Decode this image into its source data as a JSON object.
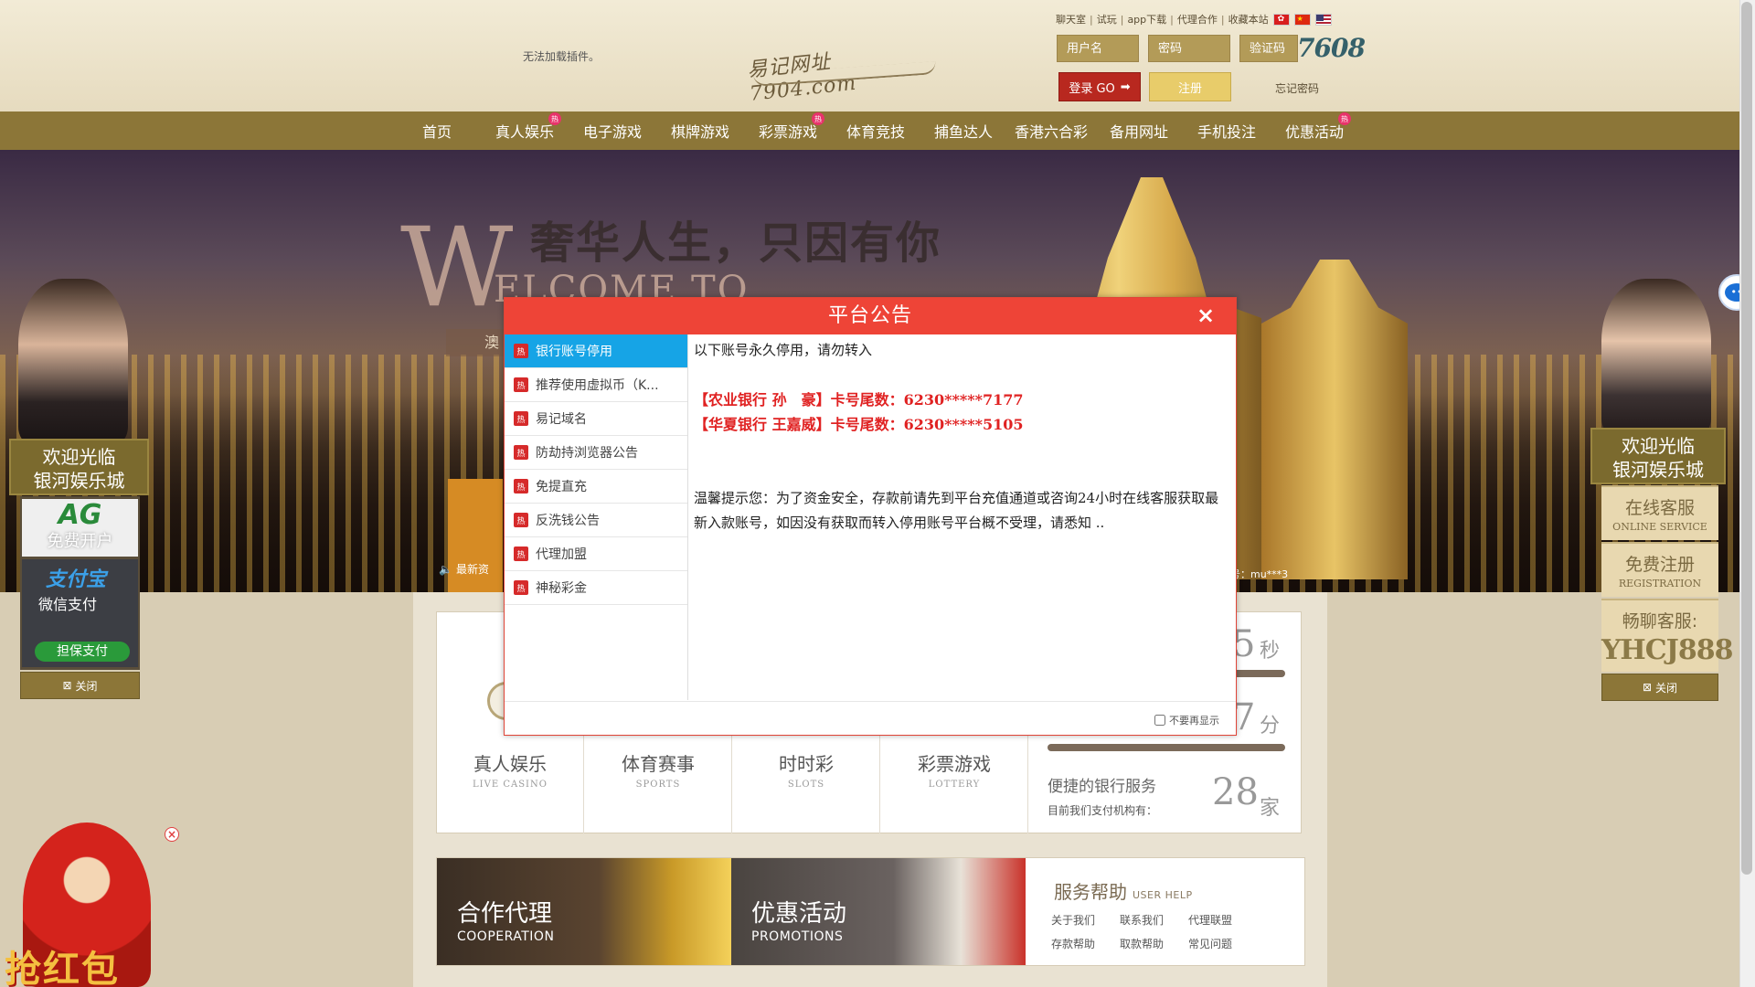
{
  "header": {
    "plugin_message": "无法加载插件。",
    "logo_text": "易记网址 7904.com",
    "top_links": [
      "聊天室",
      "试玩",
      "app下载",
      "代理合作",
      "收藏本站"
    ],
    "login": {
      "username_placeholder": "用户名",
      "password_placeholder": "密码",
      "captcha_placeholder": "验证码",
      "captcha_code": "7608",
      "login_label": "登录 GO",
      "register_label": "注册",
      "forgot_label": "忘记密码"
    }
  },
  "nav": {
    "items": [
      {
        "label": "首页",
        "hot": false
      },
      {
        "label": "真人娱乐",
        "hot": true
      },
      {
        "label": "电子游戏",
        "hot": false
      },
      {
        "label": "棋牌游戏",
        "hot": false
      },
      {
        "label": "彩票游戏",
        "hot": true
      },
      {
        "label": "体育竞技",
        "hot": false
      },
      {
        "label": "捕鱼达人",
        "hot": false
      },
      {
        "label": "香港六合彩",
        "hot": false
      },
      {
        "label": "备用网址",
        "hot": false
      },
      {
        "label": "手机投注",
        "hot": false
      },
      {
        "label": "优惠活动",
        "hot": true
      }
    ],
    "hot_badge": "热"
  },
  "banner": {
    "slogan": "奢华人生，只因有你",
    "big_letter": "W",
    "welcome": "ELCOME TO",
    "sub_text": "澳",
    "marquee": "最新资",
    "member_tail": "号：mu***3"
  },
  "stats": {
    "categories": [
      {
        "title": "真人娱乐",
        "en": "LIVE CASINO"
      },
      {
        "title": "体育赛事",
        "en": "SPORTS"
      },
      {
        "title": "时时彩",
        "en": "SLOTS"
      },
      {
        "title": "彩票游戏",
        "en": "LOTTERY"
      }
    ],
    "row1": {
      "num": "5",
      "unit": "秒"
    },
    "row2": {
      "num": "7",
      "unit": "分"
    },
    "bank": {
      "title": "便捷的银行服务",
      "sub": "目前我们支付机构有：",
      "num": "28",
      "unit": "家"
    }
  },
  "promos": [
    {
      "title": "合作代理",
      "en": "COOPERATION"
    },
    {
      "title": "优惠活动",
      "en": "PROMOTIONS"
    }
  ],
  "help": {
    "title": "服务帮助",
    "en": "USER HELP",
    "links": [
      "关于我们",
      "联系我们",
      "代理联盟",
      "存款帮助",
      "取款帮助",
      "常见问题"
    ]
  },
  "side_left": {
    "head_line1": "欢迎光临",
    "head_line2": "银河娱乐城",
    "ag_logo": "AG",
    "ag_text": "免费开户",
    "alipay": "支付宝",
    "wechat_pay": "微信支付",
    "guarantee": "担保支付",
    "close_label": "关闭"
  },
  "side_right": {
    "head_line1": "欢迎光临",
    "head_line2": "银河娱乐城",
    "online_cn": "在线客服",
    "online_en": "ONLINE SERVICE",
    "reg_cn": "免费注册",
    "reg_en": "REGISTRATION",
    "chat_cn": "畅聊客服:",
    "chat_id": "YHCJ888",
    "close_label": "关闭"
  },
  "red_envelope": {
    "text": "抢红包",
    "close": "×"
  },
  "modal": {
    "title": "平台公告",
    "close": "×",
    "items": [
      {
        "label": "银行账号停用",
        "active": true
      },
      {
        "label": "推荐使用虚拟币（K...",
        "active": false
      },
      {
        "label": "易记域名",
        "active": false
      },
      {
        "label": "防劫持浏览器公告",
        "active": false
      },
      {
        "label": "免提直充",
        "active": false
      },
      {
        "label": "反洗钱公告",
        "active": false
      },
      {
        "label": "代理加盟",
        "active": false
      },
      {
        "label": "神秘彩金",
        "active": false
      }
    ],
    "item_icon": "热",
    "body_intro": "以下账号永久停用，请勿转入",
    "bank_line1": "【农业银行 孙　豪】卡号尾数：6230*****7177",
    "bank_line2": "【华夏银行 王嘉威】卡号尾数：6230*****5105",
    "tip": "温馨提示您：为了资金安全，存款前请先到平台充值通道或咨询24小时在线客服获取最新入款账号，如因没有获取而转入停用账号平台概不受理，请悉知 ..",
    "dont_show": "不要再显示"
  }
}
